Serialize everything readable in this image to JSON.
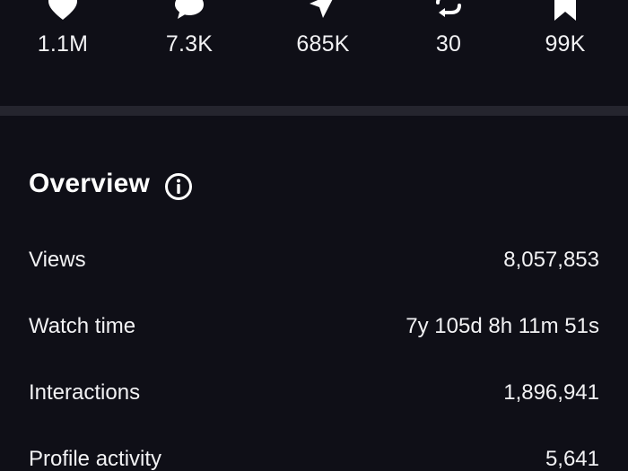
{
  "stats": [
    {
      "icon": "heart-icon",
      "value": "1.1M"
    },
    {
      "icon": "comment-icon",
      "value": "7.3K"
    },
    {
      "icon": "share-icon",
      "value": "685K"
    },
    {
      "icon": "repost-icon",
      "value": "30"
    },
    {
      "icon": "bookmark-icon",
      "value": "99K"
    }
  ],
  "overview": {
    "title": "Overview",
    "info_icon": "info-icon",
    "metrics": [
      {
        "label": "Views",
        "value": "8,057,853"
      },
      {
        "label": "Watch time",
        "value": "7y 105d 8h 11m 51s"
      },
      {
        "label": "Interactions",
        "value": "1,896,941"
      },
      {
        "label": "Profile activity",
        "value": "5,641"
      }
    ]
  },
  "colors": {
    "background": "#0f0f17",
    "divider": "#25252e",
    "text": "#f2f2f4"
  }
}
